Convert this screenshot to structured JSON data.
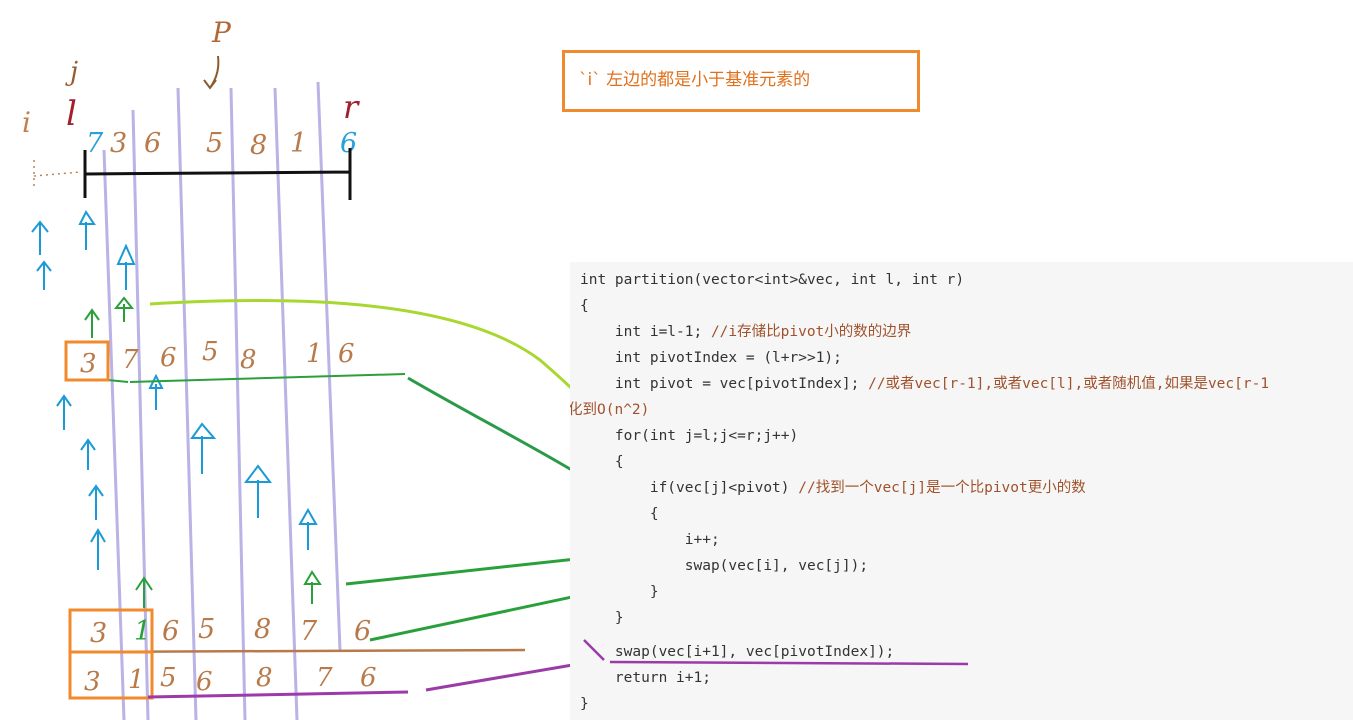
{
  "note": {
    "text": "`i` 左边的都是小于基准元素的"
  },
  "labels": {
    "p": "P",
    "j": "j",
    "i": "i",
    "l": "l",
    "r": "r"
  },
  "rows": {
    "row1": [
      "7",
      "3",
      "6",
      "5",
      "8",
      "1",
      "6"
    ],
    "row2": [
      "3",
      "7",
      "6",
      "5",
      "8",
      "1",
      "6"
    ],
    "row3": [
      "3",
      "1",
      "6",
      "5",
      "8",
      "7",
      "6"
    ],
    "row4": [
      "3",
      "1",
      "5",
      "6",
      "8",
      "7",
      "6"
    ]
  },
  "code": {
    "line1": "int partition(vector<int>&vec, int l, int r)",
    "line2": "{",
    "line3a": "    int i=l-1; ",
    "line3b": "//i存储比pivot小的数的边界",
    "line4": "    int pivotIndex = (l+r>>1);",
    "line5a": "    int pivot = vec[pivotIndex]; ",
    "line5b": "//或者vec[r-1],或者vec[l],或者随机值,如果是vec[r-1",
    "line6": "化到O(n^2)",
    "line7": "    for(int j=l;j<=r;j++)",
    "line8": "    {",
    "line9a": "        if(vec[j]<pivot) ",
    "line9b": "//找到一个vec[j]是一个比pivot更小的数",
    "line10": "        {",
    "line11": "            i++;",
    "line12": "            swap(vec[i], vec[j]);",
    "line13": "        }",
    "line14": "    }",
    "line15": "    swap(vec[i+1], vec[pivotIndex]);",
    "line16": "    return i+1;",
    "line17": "}"
  }
}
